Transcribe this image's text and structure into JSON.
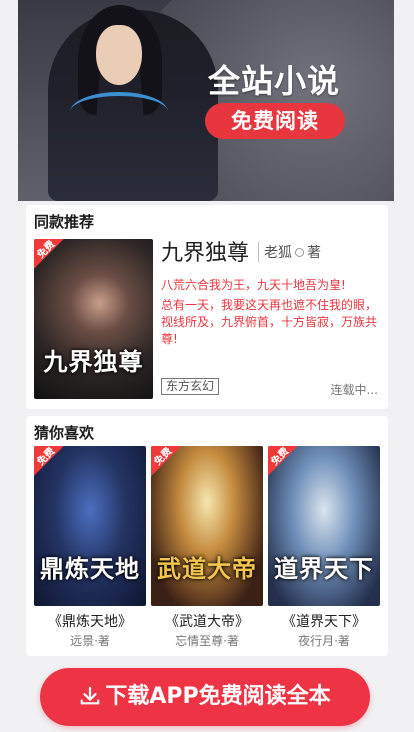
{
  "banner": {
    "title": "全站小说",
    "pill": "免费阅读"
  },
  "recommend": {
    "section_title": "同款推荐",
    "book": {
      "badge": "免费",
      "cover_title": "九界独尊",
      "name": "九界独尊",
      "author": "老狐",
      "author_suffix": "著",
      "desc1": "八荒六合我为王，九天十地吾为皇!",
      "desc2": "总有一天，我要这天再也遮不住我的眼，视线所及，九界俯首，十方皆寂，万族共尊!",
      "tag": "东方玄幻",
      "status": "连载中..."
    }
  },
  "guess": {
    "section_title": "猜你喜欢",
    "books": [
      {
        "badge": "免费",
        "cover_title": "鼎炼天地",
        "name": "《鼎炼天地》",
        "author": "远景·著"
      },
      {
        "badge": "免费",
        "cover_title": "武道大帝",
        "name": "《武道大帝》",
        "author": "忘情至尊·著"
      },
      {
        "badge": "免费",
        "cover_title": "道界天下",
        "name": "《道界天下》",
        "author": "夜行月·著"
      }
    ]
  },
  "cta": {
    "label": "下载APP免费阅读全本"
  },
  "colors": {
    "accent": "#ee3444",
    "background": "#f1f1f3"
  }
}
